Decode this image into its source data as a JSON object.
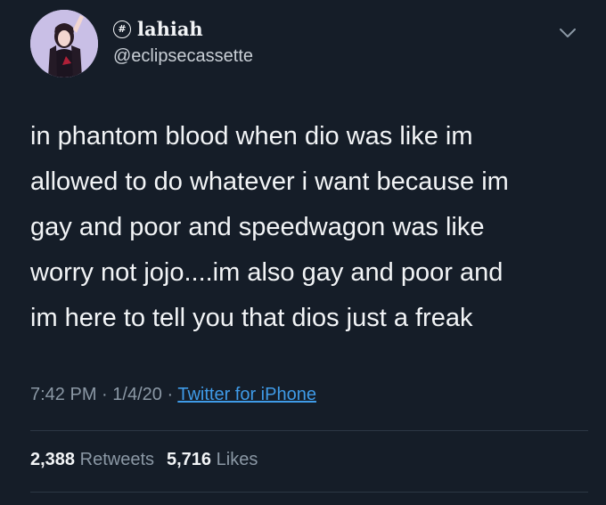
{
  "author": {
    "display_name": "lahiah",
    "badge": "#",
    "handle": "@eclipsecassette"
  },
  "tweet": {
    "lines": [
      "in phantom blood when dio was like im",
      "allowed to do whatever i want because im",
      "gay and poor and speedwagon was like",
      "worry not jojo....im also gay and poor and",
      "im here to tell you that dios just a freak"
    ],
    "time": "7:42 PM",
    "separator": "·",
    "date": "1/4/20",
    "source": "Twitter for iPhone"
  },
  "stats": {
    "retweets_count": "2,388",
    "retweets_label": "Retweets",
    "likes_count": "5,716",
    "likes_label": "Likes"
  },
  "colors": {
    "background": "#151d28",
    "text": "#f2f4f6",
    "muted": "#8b98a5",
    "link": "#3f9be8",
    "avatar_bg": "#c9bfe6"
  },
  "icons": {
    "menu": "chevron-down-icon",
    "badge": "hash-badge-icon"
  }
}
